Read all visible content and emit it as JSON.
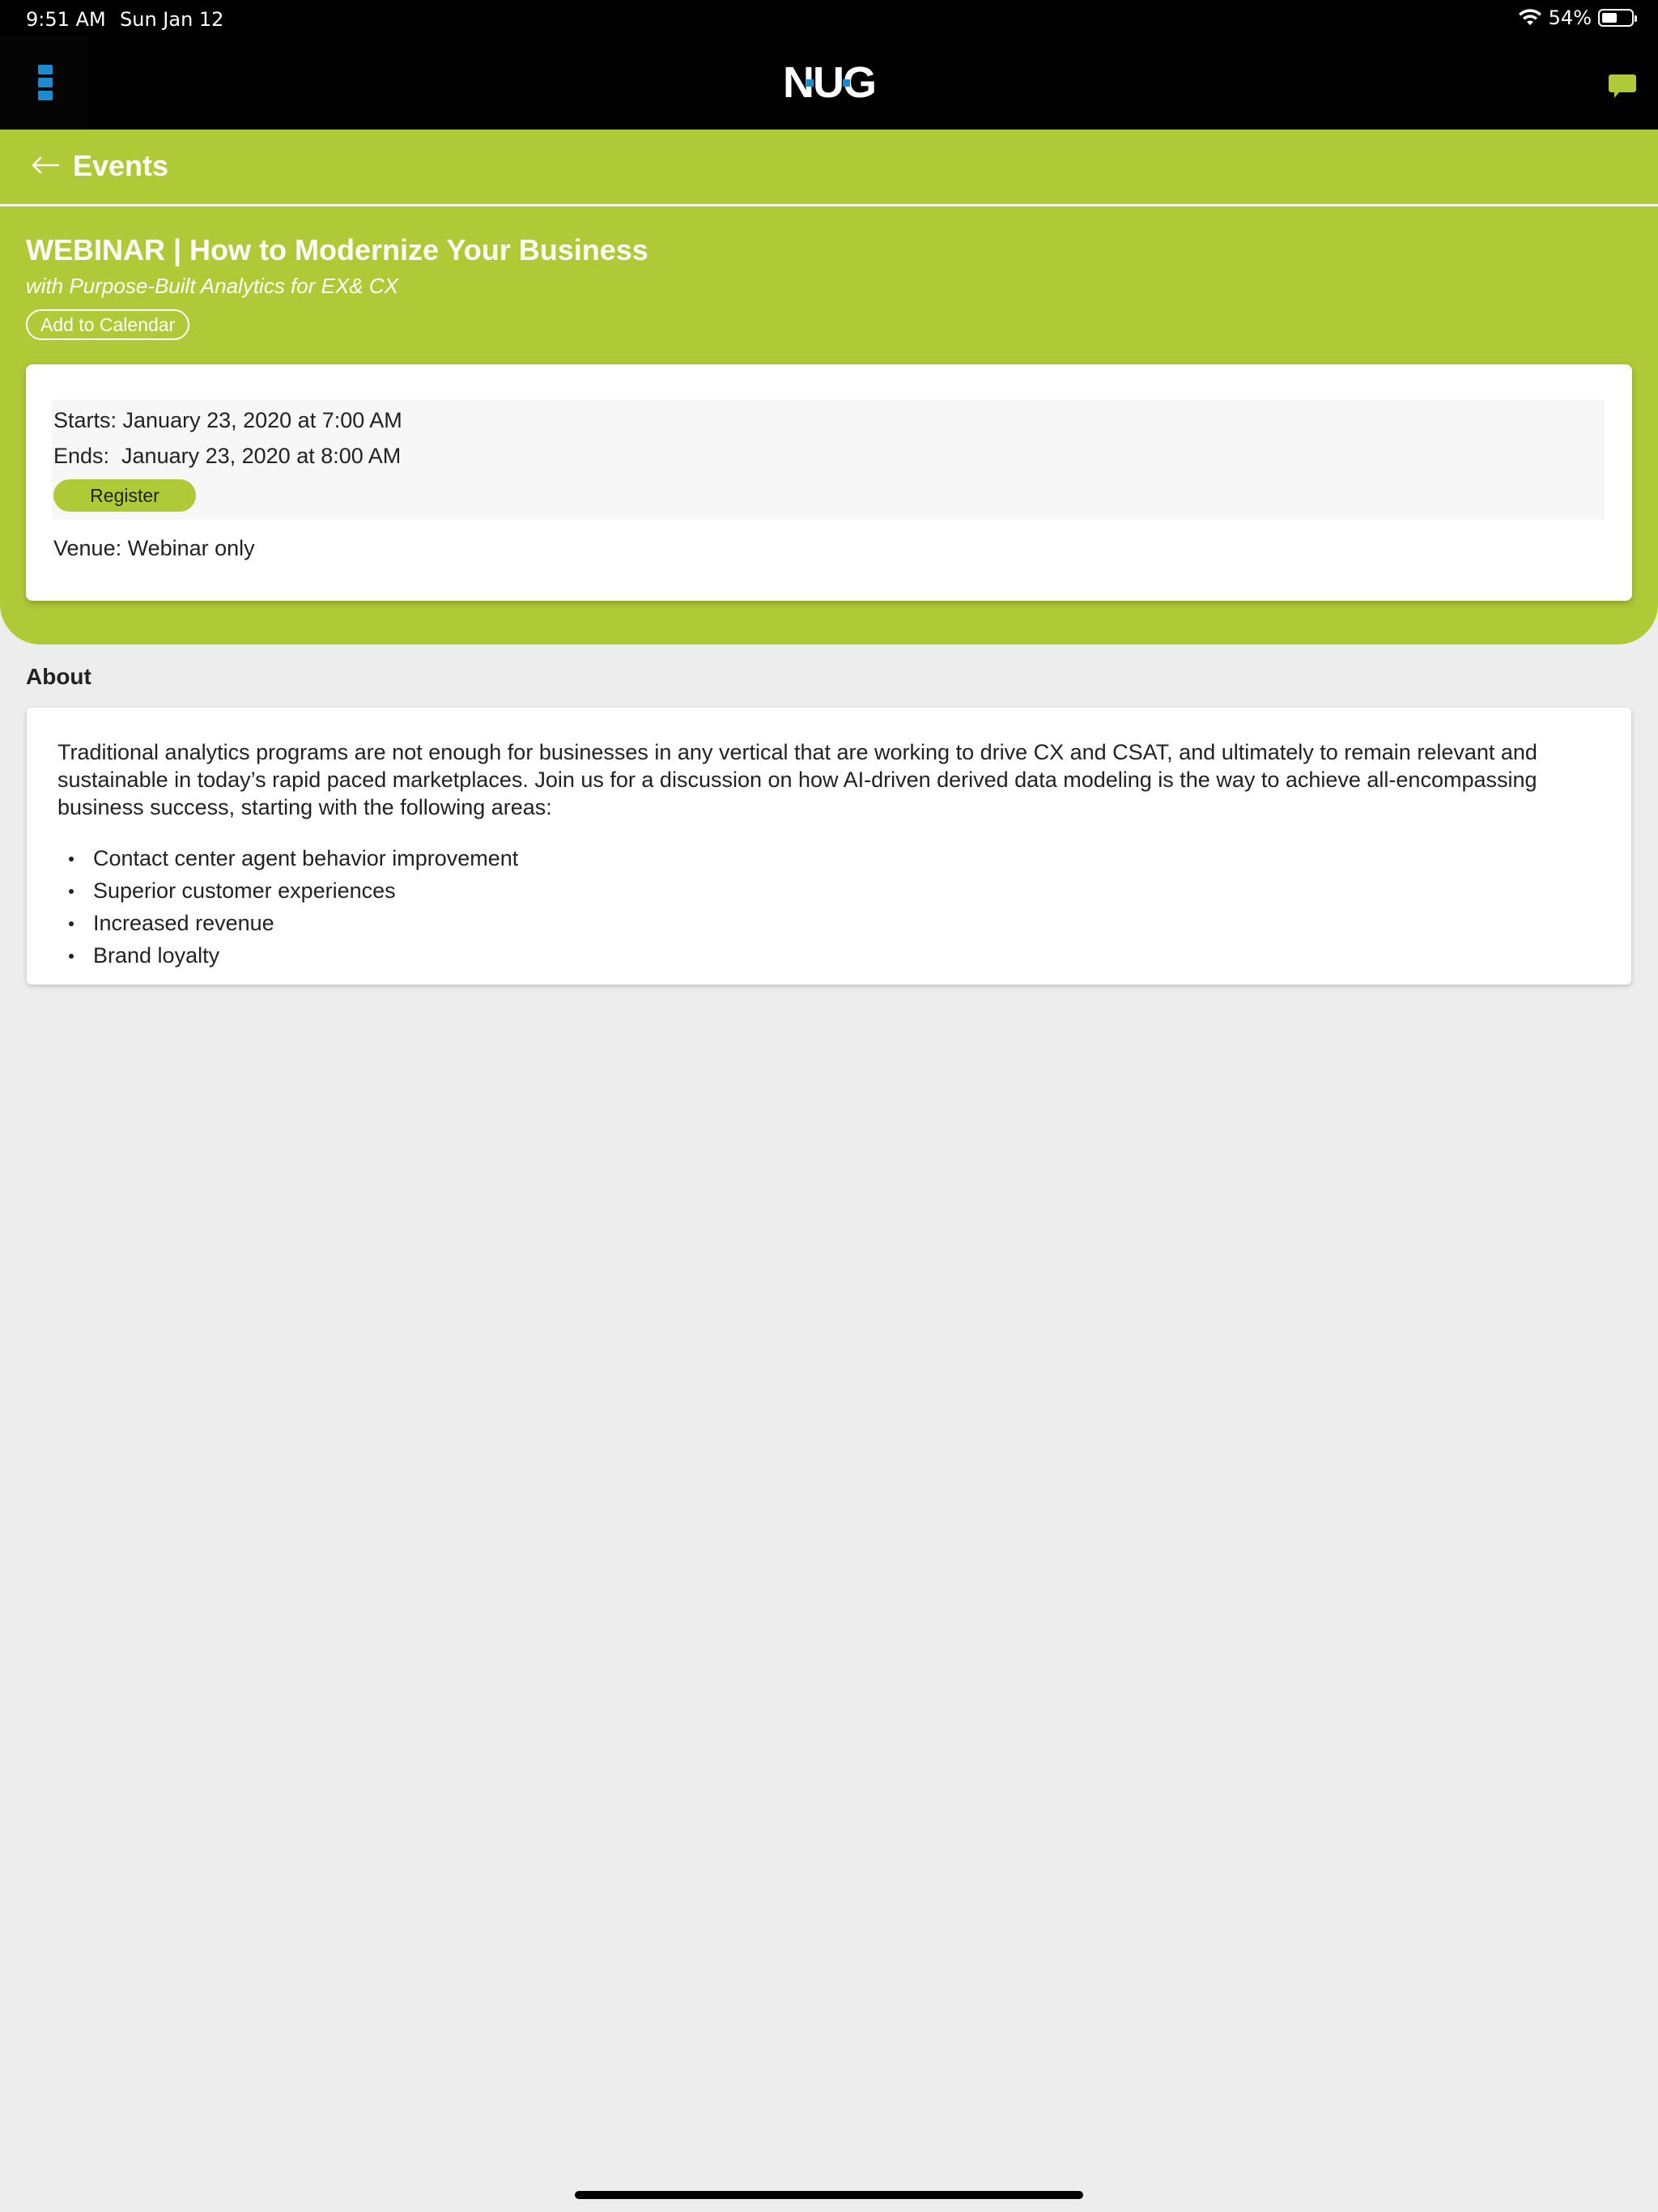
{
  "status_bar": {
    "time": "9:51 AM",
    "date": "Sun Jan 12",
    "battery_text": "54%",
    "battery_level": 0.54
  },
  "header": {
    "logo_text": "NUG",
    "menu_icon": "menu-icon",
    "chat_icon": "chat-icon",
    "brand_colors": {
      "blue": "#1e8bd1",
      "green": "#b0c937"
    }
  },
  "nav": {
    "back_icon": "arrow-left-icon",
    "title": "Events"
  },
  "event": {
    "title": "WEBINAR | How to Modernize Your Business",
    "subtitle": "with Purpose-Built Analytics for EX& CX",
    "add_to_calendar_label": "Add to Calendar",
    "starts": "Starts: January 23, 2020 at 7:00 AM",
    "ends": "Ends:  January 23, 2020 at 8:00 AM",
    "register_label": "Register",
    "venue": "Venue: Webinar only"
  },
  "about": {
    "heading": "About",
    "body": "Traditional analytics programs are not enough for businesses in any vertical that are working to drive CX and CSAT, and ultimately to remain relevant and sustainable in today’s rapid paced marketplaces. Join us for a discussion on how AI-driven derived data modeling is the way to achieve all-encompassing business success, starting with the following areas:",
    "items": [
      "Contact center agent behavior improvement",
      "Superior customer experiences",
      "Increased revenue",
      "Brand loyalty"
    ]
  }
}
